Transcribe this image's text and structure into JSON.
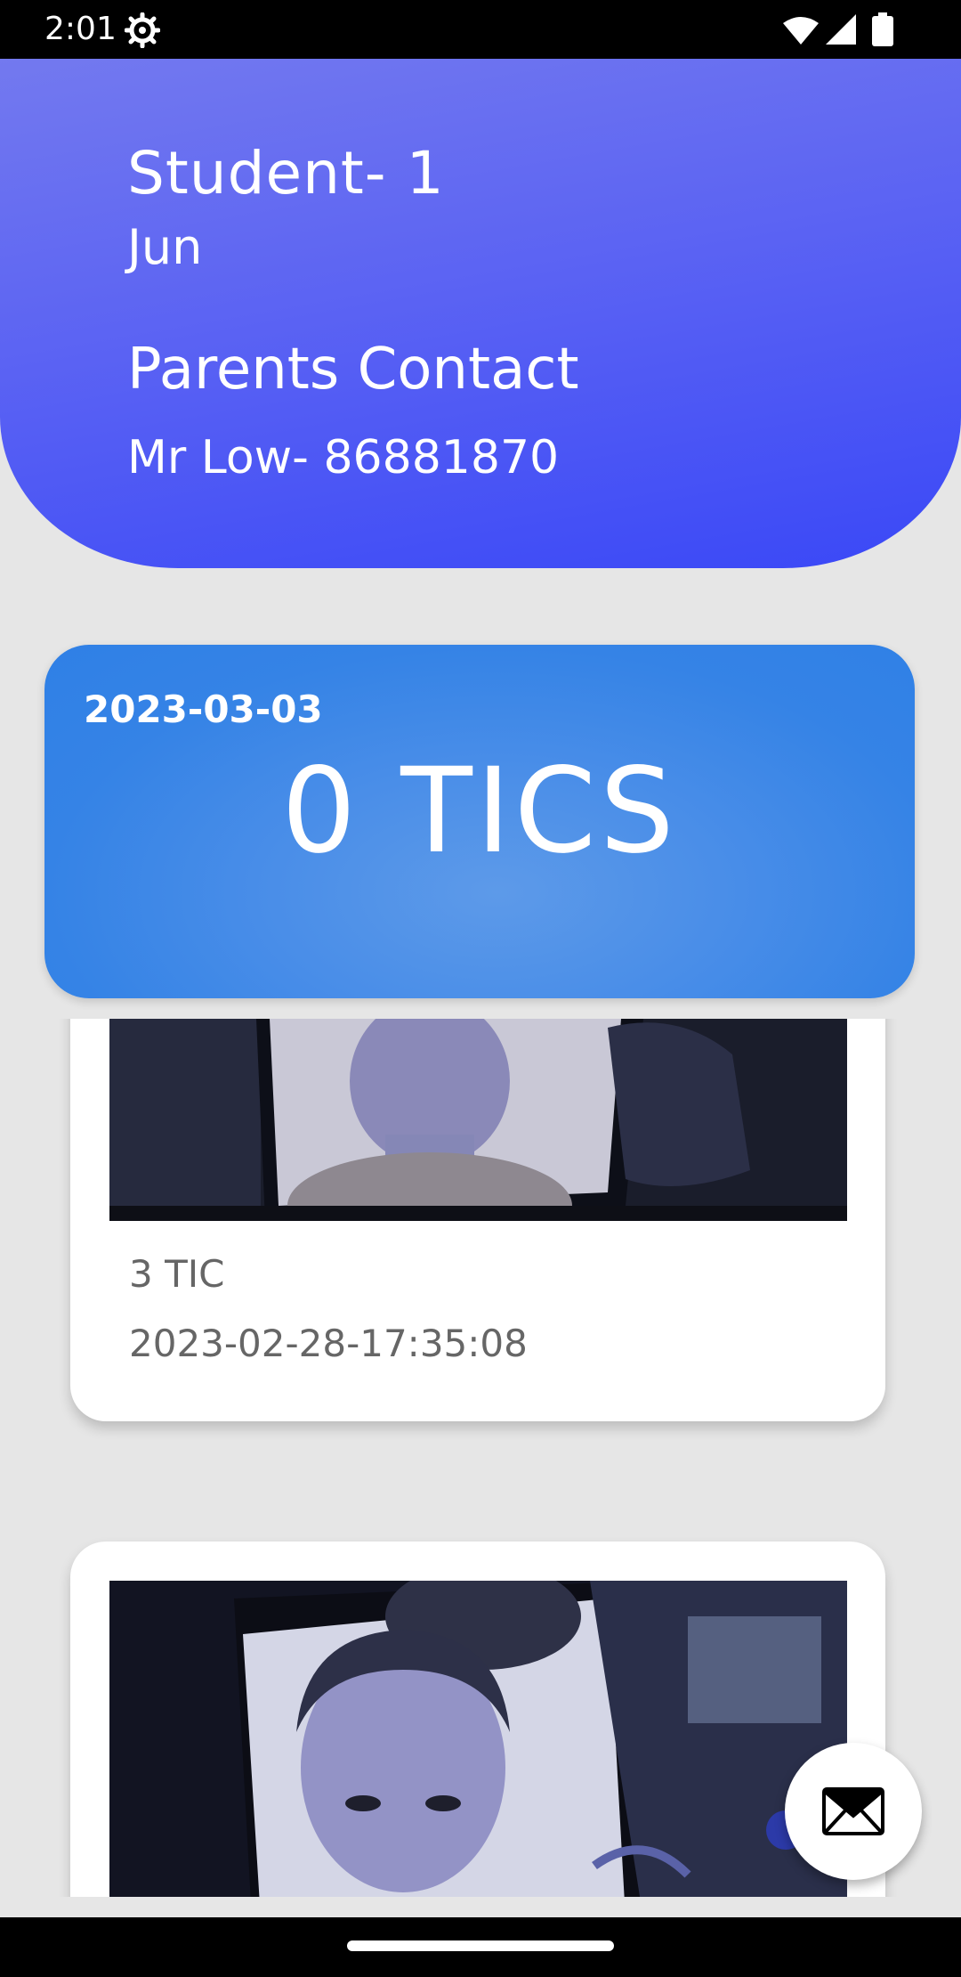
{
  "status_bar": {
    "time": "2:01",
    "icons": [
      "settings-gear-icon",
      "wifi-icon",
      "signal-icon",
      "battery-icon"
    ]
  },
  "header": {
    "student_title": "Student- 1",
    "student_name": "Jun",
    "parents_title": "Parents Contact",
    "parents_contact": "Mr Low-  86881870"
  },
  "summary": {
    "date": "2023-03-03",
    "count": "0 TICS"
  },
  "records": [
    {
      "tic": "3 TIC",
      "timestamp": "2023-02-28-17:35:08"
    }
  ],
  "fab": {
    "icon": "envelope-icon"
  },
  "colors": {
    "header_gradient_start": "#7379ef",
    "header_gradient_end": "#3a48f7",
    "summary_blue": "#3583e6",
    "background": "#e6e6e6"
  }
}
